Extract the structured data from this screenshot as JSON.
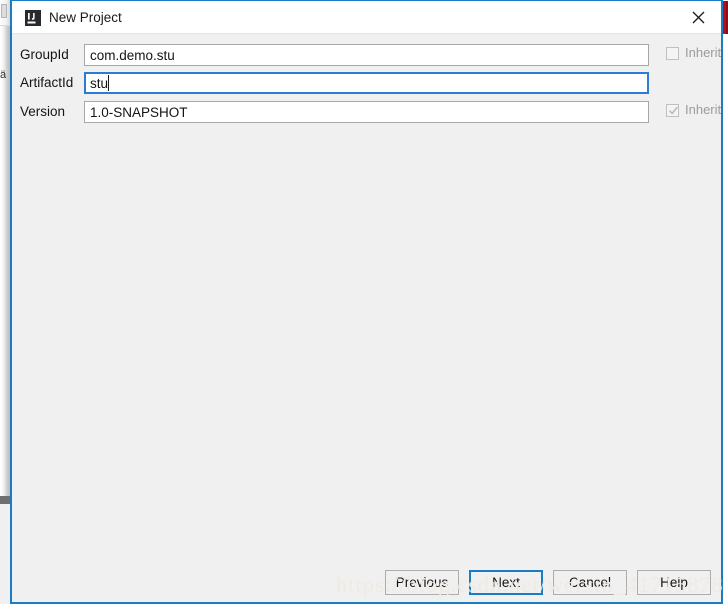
{
  "window": {
    "title": "New Project",
    "app_icon": "intellij-idea-icon",
    "close_icon": "close-icon",
    "accent_color": "#1a7dc4",
    "titlebar_bg": "#ffffff",
    "body_bg": "#f0f0f0",
    "parent_accent_color": "#b60d1e"
  },
  "form": {
    "rows": [
      {
        "label": "GroupId",
        "value": "com.demo.stu",
        "placeholder": "",
        "focused": false,
        "inherit": {
          "label": "Inherit",
          "checked": false,
          "disabled": true
        }
      },
      {
        "label": "ArtifactId",
        "value": "stu",
        "placeholder": "",
        "focused": true,
        "inherit": null
      },
      {
        "label": "Version",
        "value": "1.0-SNAPSHOT",
        "placeholder": "",
        "focused": false,
        "inherit": {
          "label": "Inherit",
          "checked": true,
          "disabled": true
        }
      }
    ]
  },
  "footer": {
    "buttons": [
      {
        "label": "Previous",
        "focused": false
      },
      {
        "label": "Next",
        "focused": true
      },
      {
        "label": "Cancel",
        "focused": false
      },
      {
        "label": "Help",
        "focused": false
      }
    ]
  },
  "watermark": {
    "text": "https://blog.csdn.net/weixin_41715878"
  }
}
